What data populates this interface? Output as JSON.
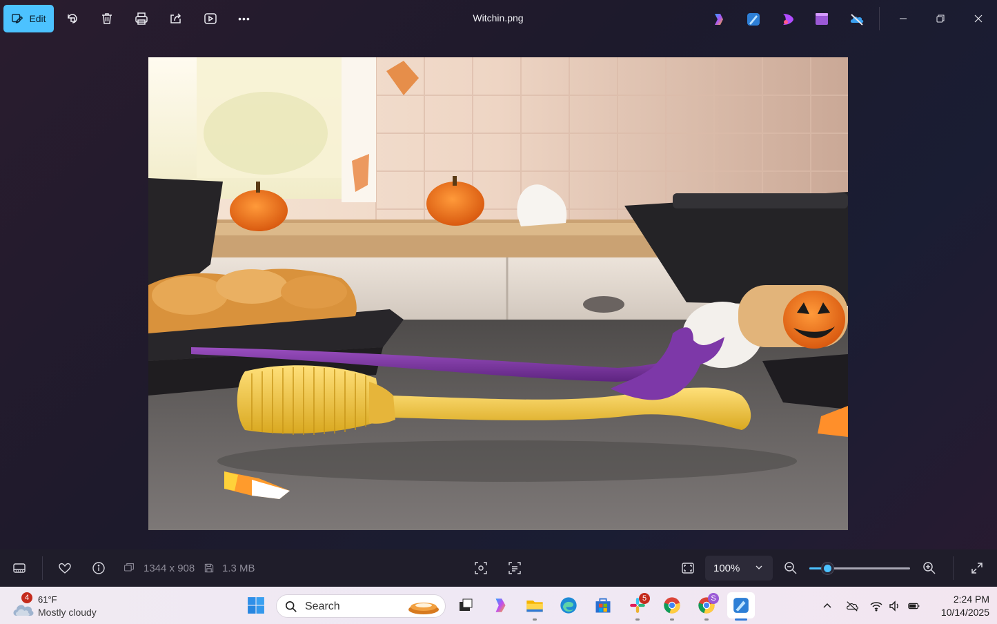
{
  "titlebar": {
    "edit_label": "Edit",
    "file_name": "Witchin.png",
    "more_label": "•••"
  },
  "bottombar": {
    "dimensions": "1344 x 908",
    "file_size": "1.3 MB",
    "zoom_level": "100%",
    "zoom_slider_fraction": 0.18
  },
  "taskbar": {
    "weather_temp": "61°F",
    "weather_condition": "Mostly cloudy",
    "weather_badge": "4",
    "search_placeholder": "Search",
    "slack_badge": "5",
    "chrome_profile_badge": "S",
    "time": "2:24 PM",
    "date": "10/14/2025"
  },
  "colors": {
    "accent": "#4cc2ff",
    "badge_red": "#c42b1c"
  }
}
